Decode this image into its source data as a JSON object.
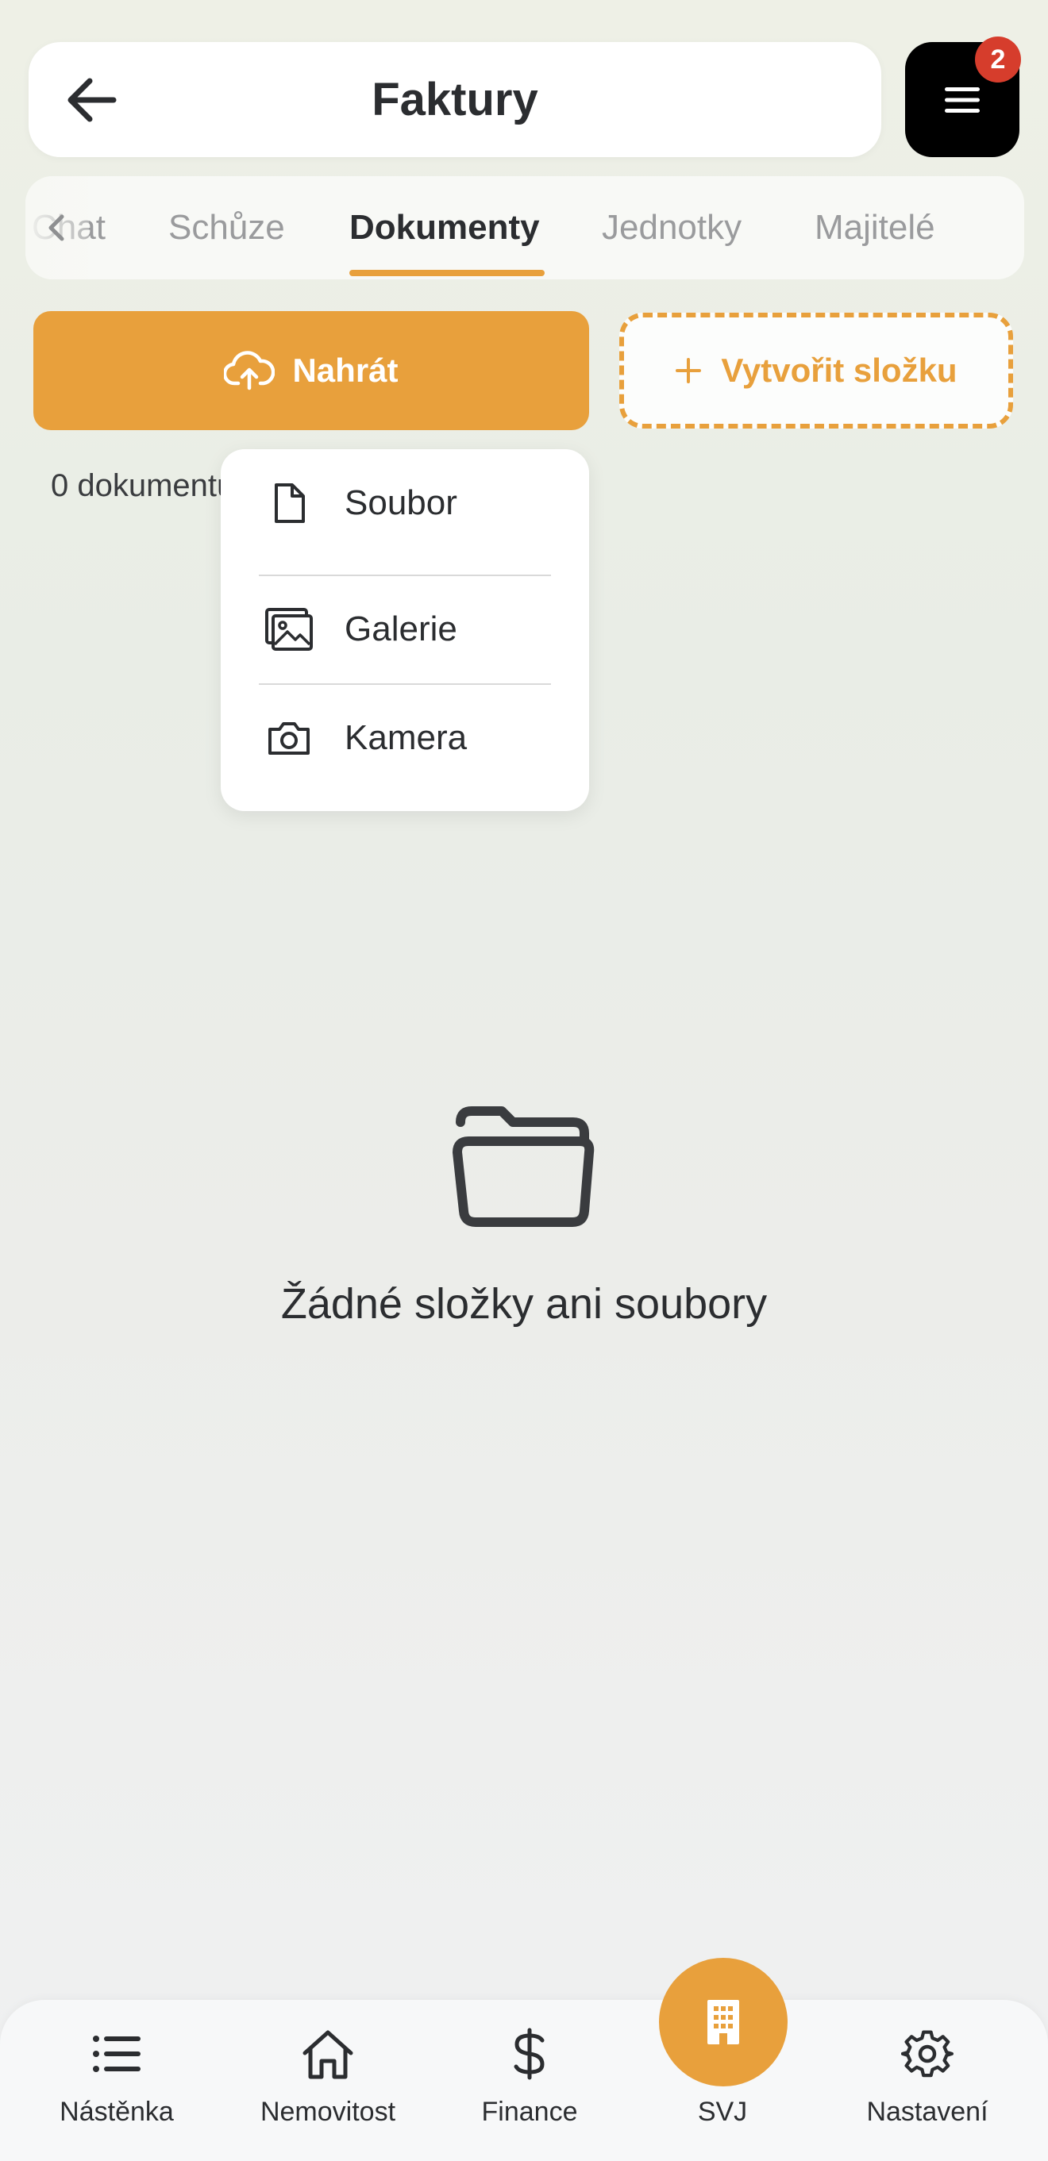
{
  "header": {
    "title": "Faktury",
    "notification_count": "2"
  },
  "tabs": [
    {
      "label": "Chat",
      "active": false
    },
    {
      "label": "Schůze",
      "active": false
    },
    {
      "label": "Dokumenty",
      "active": true
    },
    {
      "label": "Jednotky",
      "active": false
    },
    {
      "label": "Majitelé",
      "active": false
    }
  ],
  "actions": {
    "upload_label": "Nahrát",
    "create_folder_label": "Vytvořit složku"
  },
  "document_count": "0 dokumentů",
  "upload_menu": {
    "items": [
      {
        "label": "Soubor",
        "icon": "file-icon"
      },
      {
        "label": "Galerie",
        "icon": "gallery-icon"
      },
      {
        "label": "Kamera",
        "icon": "camera-icon"
      }
    ]
  },
  "empty_state": {
    "icon": "folder-open-icon",
    "text": "Žádné složky ani soubory"
  },
  "bottom_nav": {
    "items": [
      {
        "label": "Nástěnka",
        "icon": "list-icon"
      },
      {
        "label": "Nemovitost",
        "icon": "home-icon"
      },
      {
        "label": "Finance",
        "icon": "dollar-icon"
      },
      {
        "label": "SVJ",
        "icon": "building-icon",
        "active": true
      },
      {
        "label": "Nastavení",
        "icon": "gear-icon"
      }
    ]
  },
  "colors": {
    "accent": "#e8a03c",
    "badge": "#d63d2c",
    "text": "#2b2d30",
    "muted_tab": "#9a9b9d"
  }
}
